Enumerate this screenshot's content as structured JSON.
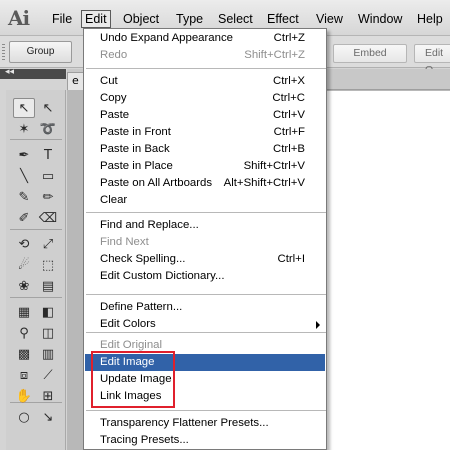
{
  "app": {
    "logo": "Ai"
  },
  "menubar": {
    "items": [
      {
        "label": "File"
      },
      {
        "label": "Edit",
        "active": true
      },
      {
        "label": "Object"
      },
      {
        "label": "Type"
      },
      {
        "label": "Select"
      },
      {
        "label": "Effect"
      },
      {
        "label": "View"
      },
      {
        "label": "Window"
      },
      {
        "label": "Help"
      }
    ]
  },
  "controlbar": {
    "group_label": "Group",
    "embed_label": "Embed",
    "edit_label": "Edit O"
  },
  "document": {
    "tab_label": "e"
  },
  "panel": {
    "collapse_glyph": "◂◂"
  },
  "tools": [
    {
      "name": "selection-tool-icon",
      "glyph": "↖",
      "selected": true
    },
    {
      "name": "direct-selection-tool-icon",
      "glyph": "↖"
    },
    {
      "name": "magic-wand-tool-icon",
      "glyph": "✶"
    },
    {
      "name": "lasso-tool-icon",
      "glyph": "➰"
    },
    {
      "name": "pen-tool-icon",
      "glyph": "✒"
    },
    {
      "name": "type-tool-icon",
      "glyph": "T"
    },
    {
      "name": "line-tool-icon",
      "glyph": "╲"
    },
    {
      "name": "rectangle-tool-icon",
      "glyph": "▭"
    },
    {
      "name": "paintbrush-tool-icon",
      "glyph": "✎"
    },
    {
      "name": "pencil-tool-icon",
      "glyph": "✏"
    },
    {
      "name": "blob-brush-tool-icon",
      "glyph": "✐"
    },
    {
      "name": "eraser-tool-icon",
      "glyph": "⌫"
    },
    {
      "name": "rotate-tool-icon",
      "glyph": "⟲"
    },
    {
      "name": "scale-tool-icon",
      "glyph": "⤢"
    },
    {
      "name": "warp-tool-icon",
      "glyph": "☄"
    },
    {
      "name": "free-transform-tool-icon",
      "glyph": "⬚"
    },
    {
      "name": "symbol-sprayer-tool-icon",
      "glyph": "❀"
    },
    {
      "name": "column-graph-tool-icon",
      "glyph": "▤"
    },
    {
      "name": "mesh-tool-icon",
      "glyph": "▦"
    },
    {
      "name": "gradient-tool-icon",
      "glyph": "◧"
    },
    {
      "name": "eyedropper-tool-icon",
      "glyph": "⚲"
    },
    {
      "name": "blend-tool-icon",
      "glyph": "◫"
    },
    {
      "name": "live-paint-tool-icon",
      "glyph": "▩"
    },
    {
      "name": "bar-graph-tool-icon",
      "glyph": "▥"
    },
    {
      "name": "artboard-tool-icon",
      "glyph": "⧈"
    },
    {
      "name": "slice-tool-icon",
      "glyph": "⟋"
    },
    {
      "name": "hand-tool-icon",
      "glyph": "✋"
    },
    {
      "name": "measure-tool-icon",
      "glyph": "⊞"
    },
    {
      "name": "fill-color-icon",
      "glyph": "○"
    },
    {
      "name": "stroke-color-icon",
      "glyph": "↘"
    }
  ],
  "edit_menu": {
    "sections": [
      [
        {
          "label": "Undo Expand Appearance",
          "shortcut": "Ctrl+Z"
        },
        {
          "label": "Redo",
          "shortcut": "Shift+Ctrl+Z",
          "disabled": true
        }
      ],
      [
        {
          "label": "Cut",
          "shortcut": "Ctrl+X"
        },
        {
          "label": "Copy",
          "shortcut": "Ctrl+C"
        },
        {
          "label": "Paste",
          "shortcut": "Ctrl+V"
        },
        {
          "label": "Paste in Front",
          "shortcut": "Ctrl+F"
        },
        {
          "label": "Paste in Back",
          "shortcut": "Ctrl+B"
        },
        {
          "label": "Paste in Place",
          "shortcut": "Shift+Ctrl+V"
        },
        {
          "label": "Paste on All Artboards",
          "shortcut": "Alt+Shift+Ctrl+V"
        },
        {
          "label": "Clear",
          "shortcut": ""
        }
      ],
      [
        {
          "label": "Find and Replace...",
          "shortcut": ""
        },
        {
          "label": "Find Next",
          "shortcut": "",
          "disabled": true
        },
        {
          "label": "Check Spelling...",
          "shortcut": "Ctrl+I"
        },
        {
          "label": "Edit Custom Dictionary...",
          "shortcut": ""
        }
      ],
      [
        {
          "label": "Define Pattern...",
          "shortcut": ""
        },
        {
          "label": "Edit Colors",
          "shortcut": "",
          "submenu": true
        }
      ],
      [
        {
          "label": "Edit Original",
          "shortcut": "",
          "disabled": true
        },
        {
          "label": "Edit Image",
          "shortcut": "",
          "highlighted": true
        },
        {
          "label": "Update Image",
          "shortcut": ""
        },
        {
          "label": "Link Images",
          "shortcut": ""
        }
      ],
      [
        {
          "label": "Transparency Flattener Presets...",
          "shortcut": ""
        },
        {
          "label": "Tracing Presets...",
          "shortcut": ""
        }
      ]
    ]
  },
  "colors": {
    "highlight": "#3162a8",
    "annotation_box": "#e0202c",
    "disabled_text": "#8e8e8e"
  }
}
